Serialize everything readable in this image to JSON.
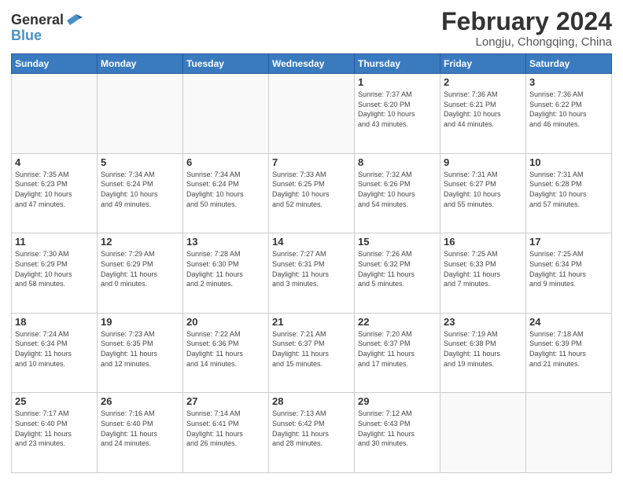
{
  "header": {
    "logo_general": "General",
    "logo_blue": "Blue",
    "title": "February 2024",
    "subtitle": "Longju, Chongqing, China"
  },
  "calendar": {
    "headers": [
      "Sunday",
      "Monday",
      "Tuesday",
      "Wednesday",
      "Thursday",
      "Friday",
      "Saturday"
    ],
    "weeks": [
      [
        {
          "day": "",
          "info": ""
        },
        {
          "day": "",
          "info": ""
        },
        {
          "day": "",
          "info": ""
        },
        {
          "day": "",
          "info": ""
        },
        {
          "day": "1",
          "info": "Sunrise: 7:37 AM\nSunset: 6:20 PM\nDaylight: 10 hours\nand 43 minutes."
        },
        {
          "day": "2",
          "info": "Sunrise: 7:36 AM\nSunset: 6:21 PM\nDaylight: 10 hours\nand 44 minutes."
        },
        {
          "day": "3",
          "info": "Sunrise: 7:36 AM\nSunset: 6:22 PM\nDaylight: 10 hours\nand 46 minutes."
        }
      ],
      [
        {
          "day": "4",
          "info": "Sunrise: 7:35 AM\nSunset: 6:23 PM\nDaylight: 10 hours\nand 47 minutes."
        },
        {
          "day": "5",
          "info": "Sunrise: 7:34 AM\nSunset: 6:24 PM\nDaylight: 10 hours\nand 49 minutes."
        },
        {
          "day": "6",
          "info": "Sunrise: 7:34 AM\nSunset: 6:24 PM\nDaylight: 10 hours\nand 50 minutes."
        },
        {
          "day": "7",
          "info": "Sunrise: 7:33 AM\nSunset: 6:25 PM\nDaylight: 10 hours\nand 52 minutes."
        },
        {
          "day": "8",
          "info": "Sunrise: 7:32 AM\nSunset: 6:26 PM\nDaylight: 10 hours\nand 54 minutes."
        },
        {
          "day": "9",
          "info": "Sunrise: 7:31 AM\nSunset: 6:27 PM\nDaylight: 10 hours\nand 55 minutes."
        },
        {
          "day": "10",
          "info": "Sunrise: 7:31 AM\nSunset: 6:28 PM\nDaylight: 10 hours\nand 57 minutes."
        }
      ],
      [
        {
          "day": "11",
          "info": "Sunrise: 7:30 AM\nSunset: 6:29 PM\nDaylight: 10 hours\nand 58 minutes."
        },
        {
          "day": "12",
          "info": "Sunrise: 7:29 AM\nSunset: 6:29 PM\nDaylight: 11 hours\nand 0 minutes."
        },
        {
          "day": "13",
          "info": "Sunrise: 7:28 AM\nSunset: 6:30 PM\nDaylight: 11 hours\nand 2 minutes."
        },
        {
          "day": "14",
          "info": "Sunrise: 7:27 AM\nSunset: 6:31 PM\nDaylight: 11 hours\nand 3 minutes."
        },
        {
          "day": "15",
          "info": "Sunrise: 7:26 AM\nSunset: 6:32 PM\nDaylight: 11 hours\nand 5 minutes."
        },
        {
          "day": "16",
          "info": "Sunrise: 7:25 AM\nSunset: 6:33 PM\nDaylight: 11 hours\nand 7 minutes."
        },
        {
          "day": "17",
          "info": "Sunrise: 7:25 AM\nSunset: 6:34 PM\nDaylight: 11 hours\nand 9 minutes."
        }
      ],
      [
        {
          "day": "18",
          "info": "Sunrise: 7:24 AM\nSunset: 6:34 PM\nDaylight: 11 hours\nand 10 minutes."
        },
        {
          "day": "19",
          "info": "Sunrise: 7:23 AM\nSunset: 6:35 PM\nDaylight: 11 hours\nand 12 minutes."
        },
        {
          "day": "20",
          "info": "Sunrise: 7:22 AM\nSunset: 6:36 PM\nDaylight: 11 hours\nand 14 minutes."
        },
        {
          "day": "21",
          "info": "Sunrise: 7:21 AM\nSunset: 6:37 PM\nDaylight: 11 hours\nand 15 minutes."
        },
        {
          "day": "22",
          "info": "Sunrise: 7:20 AM\nSunset: 6:37 PM\nDaylight: 11 hours\nand 17 minutes."
        },
        {
          "day": "23",
          "info": "Sunrise: 7:19 AM\nSunset: 6:38 PM\nDaylight: 11 hours\nand 19 minutes."
        },
        {
          "day": "24",
          "info": "Sunrise: 7:18 AM\nSunset: 6:39 PM\nDaylight: 11 hours\nand 21 minutes."
        }
      ],
      [
        {
          "day": "25",
          "info": "Sunrise: 7:17 AM\nSunset: 6:40 PM\nDaylight: 11 hours\nand 23 minutes."
        },
        {
          "day": "26",
          "info": "Sunrise: 7:16 AM\nSunset: 6:40 PM\nDaylight: 11 hours\nand 24 minutes."
        },
        {
          "day": "27",
          "info": "Sunrise: 7:14 AM\nSunset: 6:41 PM\nDaylight: 11 hours\nand 26 minutes."
        },
        {
          "day": "28",
          "info": "Sunrise: 7:13 AM\nSunset: 6:42 PM\nDaylight: 11 hours\nand 28 minutes."
        },
        {
          "day": "29",
          "info": "Sunrise: 7:12 AM\nSunset: 6:43 PM\nDaylight: 11 hours\nand 30 minutes."
        },
        {
          "day": "",
          "info": ""
        },
        {
          "day": "",
          "info": ""
        }
      ]
    ]
  }
}
